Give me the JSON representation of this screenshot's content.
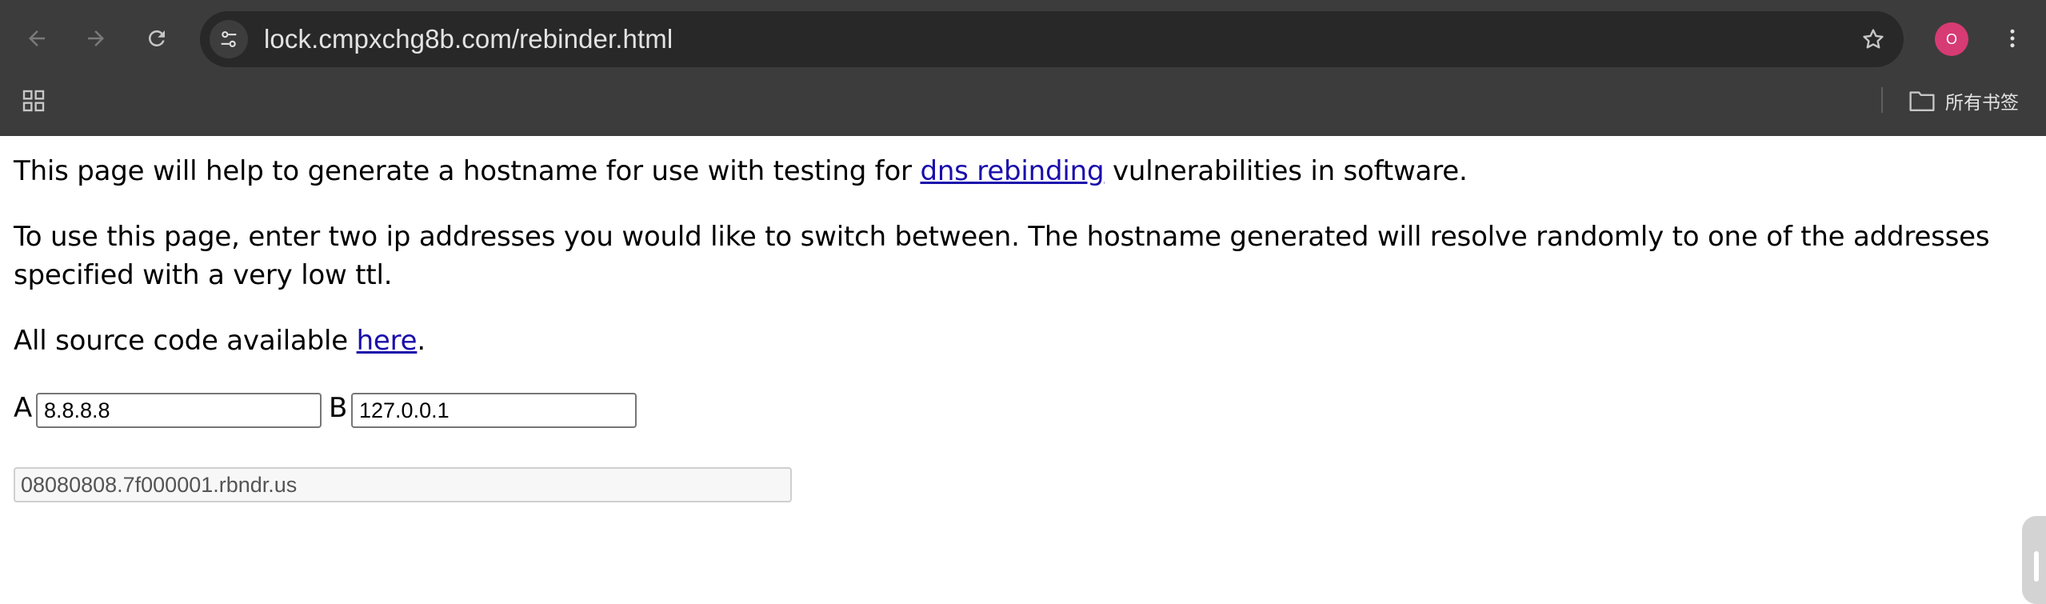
{
  "browser": {
    "url": "lock.cmpxchg8b.com/rebinder.html",
    "profile_initial": "O",
    "bookmarks_all_label": "所有书签",
    "colors": {
      "chrome_bg": "#3c3c3c",
      "omnibox_bg": "#282828",
      "profile_bg": "#d63b73",
      "link": "#1a0dab"
    },
    "icons": [
      "back-icon",
      "forward-icon",
      "reload-icon",
      "site-info-icon",
      "star-icon",
      "more-vert-icon",
      "apps-grid-icon",
      "folder-icon"
    ]
  },
  "page": {
    "intro": {
      "before": "This page will help to generate a hostname for use with testing for ",
      "link": "dns rebinding",
      "after": " vulnerabilities in software."
    },
    "instructions": "To use this page, enter two ip addresses you would like to switch between. The hostname generated will resolve randomly to one of the addresses specified with a very low ttl.",
    "source": {
      "before": "All source code available ",
      "link": "here",
      "after": "."
    },
    "ip_a": {
      "label": "A",
      "value": "8.8.8.8"
    },
    "ip_b": {
      "label": "B",
      "value": "127.0.0.1"
    },
    "hostname": "08080808.7f000001.rbndr.us"
  }
}
